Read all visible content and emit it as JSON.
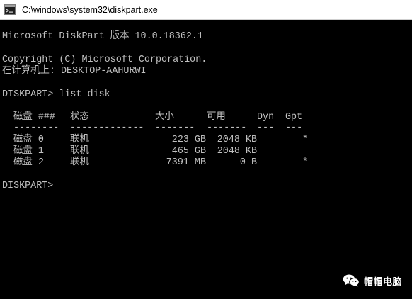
{
  "window": {
    "title": "C:\\windows\\system32\\diskpart.exe"
  },
  "console": {
    "banner": "Microsoft DiskPart 版本 10.0.18362.1",
    "copyright": "Copyright (C) Microsoft Corporation.",
    "computer": "在计算机上: DESKTOP-AAHURWI",
    "prompt_command": "DISKPART> list disk",
    "headers": {
      "disk": "磁盘 ###",
      "status": "状态",
      "size": "大小",
      "free": "可用",
      "dyn": "Dyn",
      "gpt": "Gpt"
    },
    "separators": {
      "disk": "--------",
      "status": "-------------",
      "size": "-------",
      "free": "-------",
      "dyn": "---",
      "gpt": "---"
    },
    "rows": [
      {
        "disk": "磁盘 0",
        "status": "联机",
        "size": "223 GB",
        "free": "2048 KB",
        "dyn": "",
        "gpt": "*"
      },
      {
        "disk": "磁盘 1",
        "status": "联机",
        "size": "465 GB",
        "free": "2048 KB",
        "dyn": "",
        "gpt": ""
      },
      {
        "disk": "磁盘 2",
        "status": "联机",
        "size": "7391 MB",
        "free": "0 B",
        "dyn": "",
        "gpt": "*"
      }
    ],
    "final_prompt": "DISKPART>"
  },
  "watermark": {
    "text": "帽帽电脑",
    "icon": "wechat-icon"
  },
  "colors": {
    "console_bg": "#000000",
    "console_text": "#c0c0c0",
    "titlebar_bg": "#ffffff"
  }
}
